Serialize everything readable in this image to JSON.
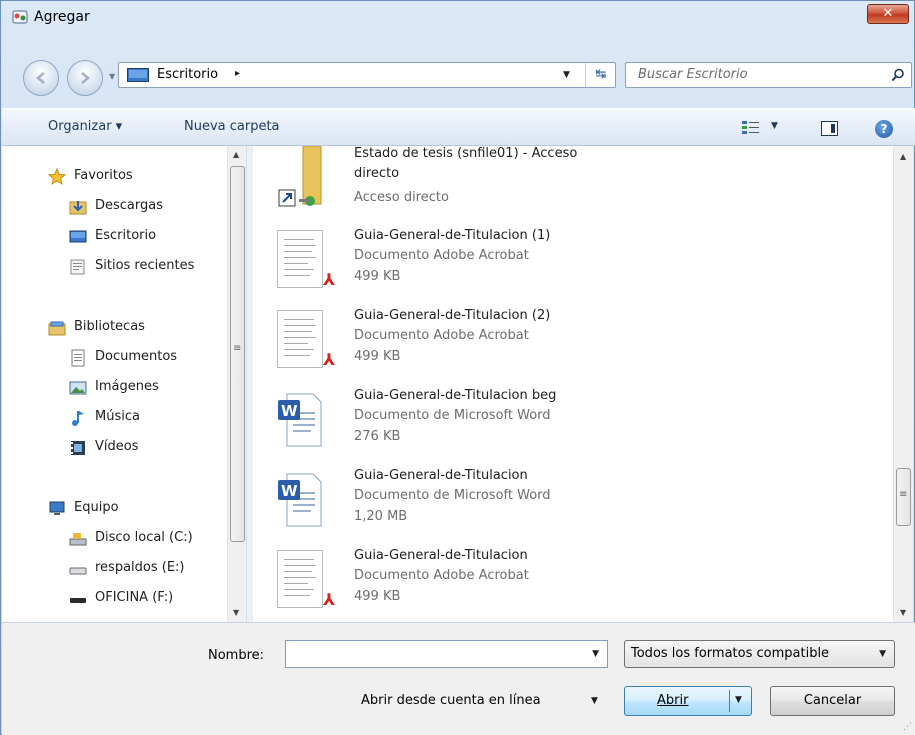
{
  "window": {
    "title": "Agregar",
    "close_symbol": "✕"
  },
  "address": {
    "location": "Escritorio",
    "separator": "▸"
  },
  "search": {
    "placeholder": "Buscar Escritorio"
  },
  "toolbar": {
    "organize": "Organizar ▾",
    "new_folder": "Nueva carpeta",
    "help": "?"
  },
  "nav": {
    "favorites": "Favoritos",
    "downloads": "Descargas",
    "desktop": "Escritorio",
    "recent": "Sitios recientes",
    "libraries": "Bibliotecas",
    "documents": "Documentos",
    "pictures": "Imágenes",
    "music": "Música",
    "videos": "Vídeos",
    "computer": "Equipo",
    "disk_c": "Disco local (C:)",
    "disk_e": "respaldos (E:)",
    "disk_f": "OFICINA (F:)"
  },
  "files": [
    {
      "name_line1": "Estado de tesis (snfile01) - Acceso",
      "name_line2": "directo",
      "type": "Acceso directo"
    },
    {
      "name": "Guia-General-de-Titulacion (1)",
      "type": "Documento Adobe Acrobat",
      "size": "499 KB"
    },
    {
      "name": "Guia-General-de-Titulacion (2)",
      "type": "Documento Adobe Acrobat",
      "size": "499 KB"
    },
    {
      "name": "Guia-General-de-Titulacion beg",
      "type": "Documento de Microsoft Word",
      "size": "276 KB"
    },
    {
      "name": "Guia-General-de-Titulacion",
      "type": "Documento de Microsoft Word",
      "size": "1,20 MB"
    },
    {
      "name": "Guia-General-de-Titulacion",
      "type": "Documento Adobe Acrobat",
      "size": "499 KB"
    }
  ],
  "bottom": {
    "name_label": "Nombre:",
    "name_value": "",
    "filter": "Todos los formatos compatible",
    "online": "Abrir desde cuenta en línea",
    "open": "Abrir",
    "cancel": "Cancelar"
  }
}
